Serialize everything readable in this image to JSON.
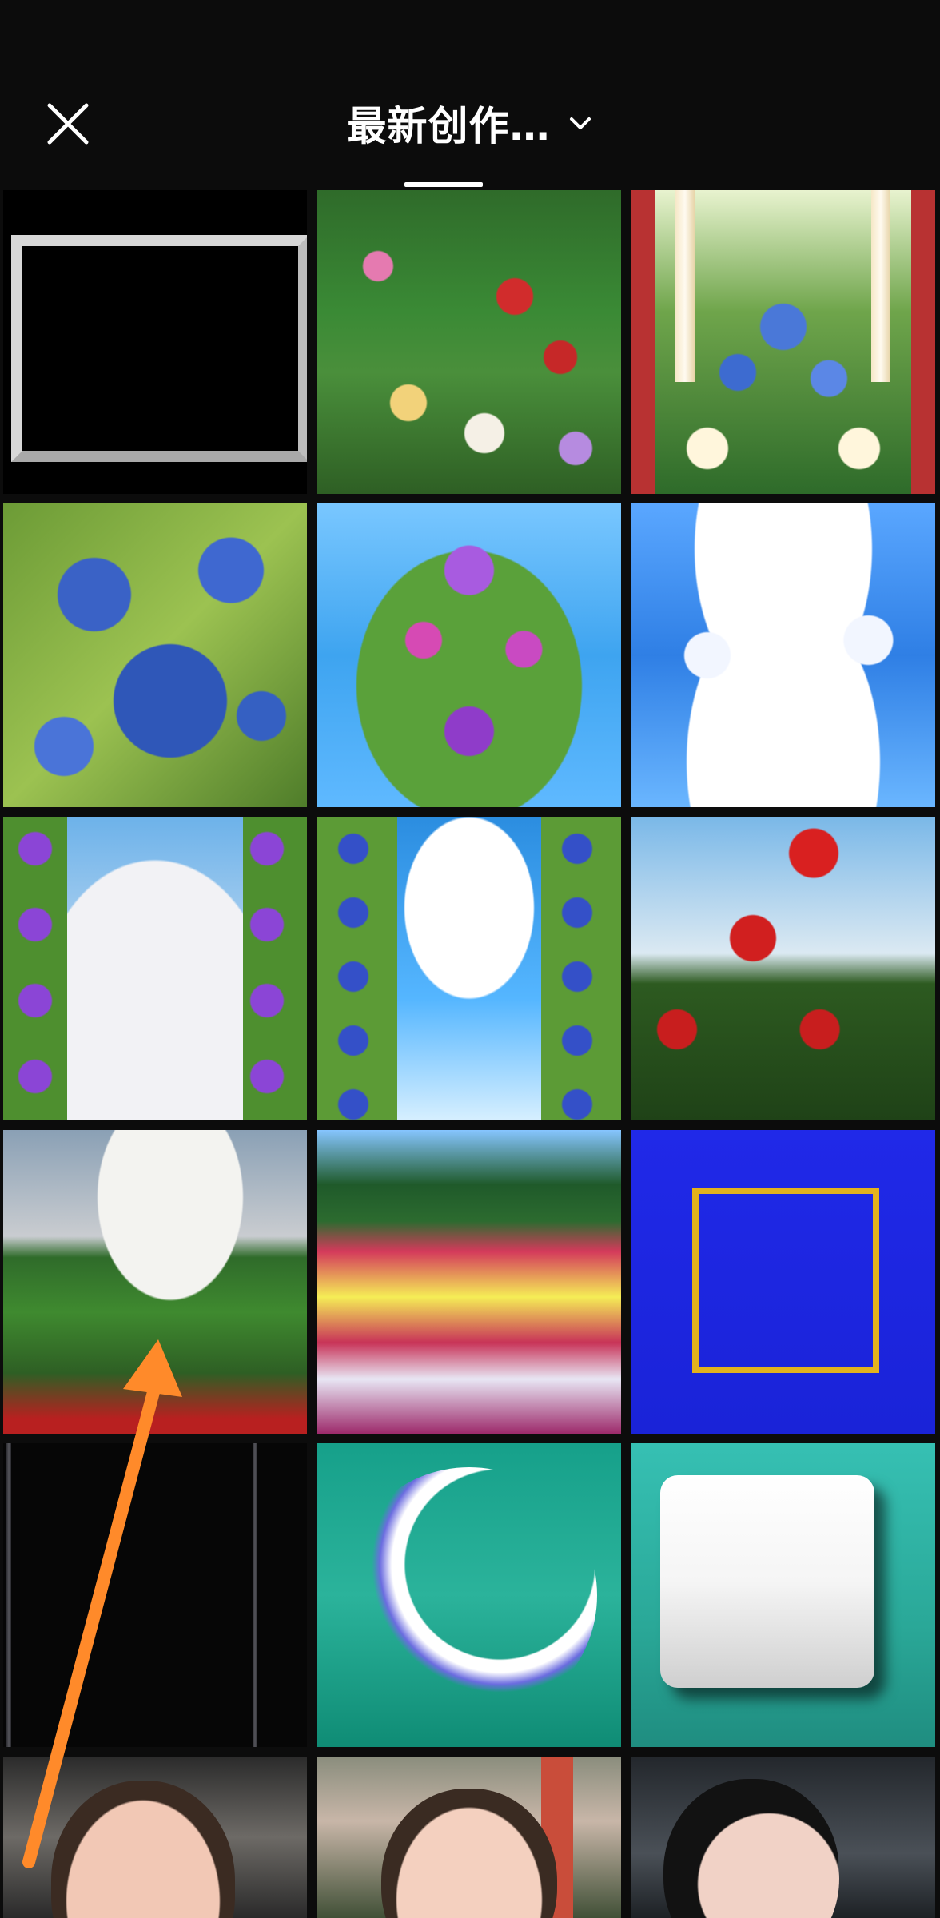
{
  "header": {
    "title": "最新创作…",
    "icons": {
      "close": "close-icon",
      "dropdown": "chevron-down-icon"
    }
  },
  "colors": {
    "background": "#0c0c0c",
    "text": "#ffffff",
    "tab_indicator": "#ffffff",
    "annotation_arrow": "#ff8a2a"
  },
  "grid": {
    "tiles": [
      {
        "name": "black-frame-thumbnail"
      },
      {
        "name": "rose-garden-thumbnail"
      },
      {
        "name": "blue-rose-gazebo-thumbnail"
      },
      {
        "name": "blue-roses-thumbnail"
      },
      {
        "name": "flower-tree-sky-thumbnail"
      },
      {
        "name": "white-roses-sky-thumbnail"
      },
      {
        "name": "purple-flowers-clouds-thumbnail"
      },
      {
        "name": "blue-flower-pillars-thumbnail"
      },
      {
        "name": "red-roses-sky-thumbnail"
      },
      {
        "name": "cloudy-field-thumbnail"
      },
      {
        "name": "colorful-meadow-thumbnail"
      },
      {
        "name": "blue-gold-frame-thumbnail"
      },
      {
        "name": "black-phone-thumbnail"
      },
      {
        "name": "blue-crescent-thumbnail"
      },
      {
        "name": "white-card-thumbnail"
      },
      {
        "name": "portrait-1-thumbnail"
      },
      {
        "name": "portrait-2-thumbnail"
      },
      {
        "name": "portrait-3-thumbnail"
      }
    ]
  }
}
